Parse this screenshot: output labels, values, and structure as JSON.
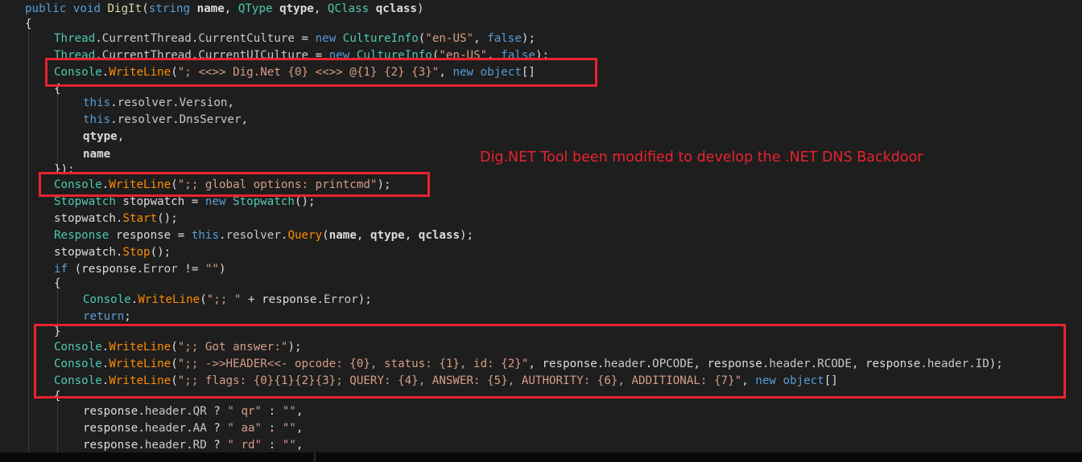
{
  "annotation": "Dig.NET Tool been modified to develop the .NET DNS Backdoor",
  "highlight_color": "#e8232f",
  "editor_background": "#1e1e1e",
  "code_lines": [
    [
      {
        "t": "public ",
        "c": "kw"
      },
      {
        "t": "void ",
        "c": "kw"
      },
      {
        "t": "DigIt",
        "c": "mb"
      },
      {
        "t": "(",
        "c": ""
      },
      {
        "t": "string ",
        "c": "kw"
      },
      {
        "t": "name",
        "c": "bd"
      },
      {
        "t": ", ",
        "c": ""
      },
      {
        "t": "QType ",
        "c": "ty"
      },
      {
        "t": "qtype",
        "c": "bd"
      },
      {
        "t": ", ",
        "c": ""
      },
      {
        "t": "QClass ",
        "c": "ty"
      },
      {
        "t": "qclass",
        "c": "bd"
      },
      {
        "t": ")",
        "c": ""
      }
    ],
    [
      {
        "t": "{",
        "c": ""
      }
    ],
    [
      {
        "t": "Thread",
        "c": "ty"
      },
      {
        "t": ".",
        "c": ""
      },
      {
        "t": "CurrentThread",
        "c": "pr"
      },
      {
        "t": ".",
        "c": ""
      },
      {
        "t": "CurrentCulture",
        "c": "pr"
      },
      {
        "t": " = ",
        "c": ""
      },
      {
        "t": "new ",
        "c": "kw"
      },
      {
        "t": "CultureInfo",
        "c": "ty"
      },
      {
        "t": "(",
        "c": ""
      },
      {
        "t": "\"en-US\"",
        "c": "st"
      },
      {
        "t": ", ",
        "c": ""
      },
      {
        "t": "false",
        "c": "kw"
      },
      {
        "t": ");",
        "c": ""
      }
    ],
    [
      {
        "t": "Thread",
        "c": "ty"
      },
      {
        "t": ".",
        "c": ""
      },
      {
        "t": "CurrentThread",
        "c": "pr"
      },
      {
        "t": ".",
        "c": ""
      },
      {
        "t": "CurrentUICulture",
        "c": "pr"
      },
      {
        "t": " = ",
        "c": ""
      },
      {
        "t": "new ",
        "c": "kw"
      },
      {
        "t": "CultureInfo",
        "c": "ty"
      },
      {
        "t": "(",
        "c": ""
      },
      {
        "t": "\"en-US\"",
        "c": "st"
      },
      {
        "t": ", ",
        "c": ""
      },
      {
        "t": "false",
        "c": "kw"
      },
      {
        "t": ");",
        "c": ""
      }
    ],
    [
      {
        "t": "Console",
        "c": "ty"
      },
      {
        "t": ".",
        "c": ""
      },
      {
        "t": "WriteLine",
        "c": "fn"
      },
      {
        "t": "(",
        "c": ""
      },
      {
        "t": "\"; <<>> Dig.Net {0} <<>> @{1} {2} {3}\"",
        "c": "st"
      },
      {
        "t": ", ",
        "c": ""
      },
      {
        "t": "new ",
        "c": "kw"
      },
      {
        "t": "object",
        "c": "kw"
      },
      {
        "t": "[]",
        "c": ""
      }
    ],
    [
      {
        "t": "{",
        "c": ""
      }
    ],
    [
      {
        "t": "this",
        "c": "kw"
      },
      {
        "t": ".",
        "c": ""
      },
      {
        "t": "resolver",
        "c": "pr"
      },
      {
        "t": ".",
        "c": ""
      },
      {
        "t": "Version",
        "c": "pr"
      },
      {
        "t": ",",
        "c": ""
      }
    ],
    [
      {
        "t": "this",
        "c": "kw"
      },
      {
        "t": ".",
        "c": ""
      },
      {
        "t": "resolver",
        "c": "pr"
      },
      {
        "t": ".",
        "c": ""
      },
      {
        "t": "DnsServer",
        "c": "pr"
      },
      {
        "t": ",",
        "c": ""
      }
    ],
    [
      {
        "t": "qtype",
        "c": "bd"
      },
      {
        "t": ",",
        "c": ""
      }
    ],
    [
      {
        "t": "name",
        "c": "bd"
      }
    ],
    [
      {
        "t": "});",
        "c": ""
      }
    ],
    [
      {
        "t": "Console",
        "c": "ty"
      },
      {
        "t": ".",
        "c": ""
      },
      {
        "t": "WriteLine",
        "c": "fn"
      },
      {
        "t": "(",
        "c": ""
      },
      {
        "t": "\";; global options: printcmd\"",
        "c": "st"
      },
      {
        "t": ");",
        "c": ""
      }
    ],
    [
      {
        "t": "Stopwatch ",
        "c": "ty"
      },
      {
        "t": "stopwatch = ",
        "c": ""
      },
      {
        "t": "new ",
        "c": "kw"
      },
      {
        "t": "Stopwatch",
        "c": "ty"
      },
      {
        "t": "();",
        "c": ""
      }
    ],
    [
      {
        "t": "stopwatch.",
        "c": ""
      },
      {
        "t": "Start",
        "c": "fn"
      },
      {
        "t": "();",
        "c": ""
      }
    ],
    [
      {
        "t": "Response ",
        "c": "ty"
      },
      {
        "t": "response = ",
        "c": ""
      },
      {
        "t": "this",
        "c": "kw"
      },
      {
        "t": ".",
        "c": ""
      },
      {
        "t": "resolver",
        "c": "pr"
      },
      {
        "t": ".",
        "c": ""
      },
      {
        "t": "Query",
        "c": "fn"
      },
      {
        "t": "(",
        "c": ""
      },
      {
        "t": "name",
        "c": "bd"
      },
      {
        "t": ", ",
        "c": ""
      },
      {
        "t": "qtype",
        "c": "bd"
      },
      {
        "t": ", ",
        "c": ""
      },
      {
        "t": "qclass",
        "c": "bd"
      },
      {
        "t": ");",
        "c": ""
      }
    ],
    [
      {
        "t": "stopwatch.",
        "c": ""
      },
      {
        "t": "Stop",
        "c": "fn"
      },
      {
        "t": "();",
        "c": ""
      }
    ],
    [
      {
        "t": "if ",
        "c": "kw"
      },
      {
        "t": "(response.",
        "c": ""
      },
      {
        "t": "Error",
        "c": "pr"
      },
      {
        "t": " != ",
        "c": ""
      },
      {
        "t": "\"\"",
        "c": "st"
      },
      {
        "t": ")",
        "c": ""
      }
    ],
    [
      {
        "t": "{",
        "c": ""
      }
    ],
    [
      {
        "t": "Console",
        "c": "ty"
      },
      {
        "t": ".",
        "c": ""
      },
      {
        "t": "WriteLine",
        "c": "fn"
      },
      {
        "t": "(",
        "c": ""
      },
      {
        "t": "\";; \"",
        "c": "st"
      },
      {
        "t": " + response.",
        "c": ""
      },
      {
        "t": "Error",
        "c": "pr"
      },
      {
        "t": ");",
        "c": ""
      }
    ],
    [
      {
        "t": "return",
        "c": "kw"
      },
      {
        "t": ";",
        "c": ""
      }
    ],
    [
      {
        "t": "}",
        "c": ""
      }
    ],
    [
      {
        "t": "Console",
        "c": "ty"
      },
      {
        "t": ".",
        "c": ""
      },
      {
        "t": "WriteLine",
        "c": "fn"
      },
      {
        "t": "(",
        "c": ""
      },
      {
        "t": "\";; Got answer:\"",
        "c": "st"
      },
      {
        "t": ");",
        "c": ""
      }
    ],
    [
      {
        "t": "Console",
        "c": "ty"
      },
      {
        "t": ".",
        "c": ""
      },
      {
        "t": "WriteLine",
        "c": "fn"
      },
      {
        "t": "(",
        "c": ""
      },
      {
        "t": "\";; ->>HEADER<<- opcode: {0}, status: {1}, id: {2}\"",
        "c": "st"
      },
      {
        "t": ", response.",
        "c": ""
      },
      {
        "t": "header",
        "c": "pr"
      },
      {
        "t": ".",
        "c": ""
      },
      {
        "t": "OPCODE",
        "c": "pr"
      },
      {
        "t": ", response.",
        "c": ""
      },
      {
        "t": "header",
        "c": "pr"
      },
      {
        "t": ".",
        "c": ""
      },
      {
        "t": "RCODE",
        "c": "pr"
      },
      {
        "t": ", response.",
        "c": ""
      },
      {
        "t": "header",
        "c": "pr"
      },
      {
        "t": ".",
        "c": ""
      },
      {
        "t": "ID",
        "c": "pr"
      },
      {
        "t": ");",
        "c": ""
      }
    ],
    [
      {
        "t": "Console",
        "c": "ty"
      },
      {
        "t": ".",
        "c": ""
      },
      {
        "t": "WriteLine",
        "c": "fn"
      },
      {
        "t": "(",
        "c": ""
      },
      {
        "t": "\";; flags: {0}{1}{2}{3}; QUERY: {4}, ANSWER: {5}, AUTHORITY: {6}, ADDITIONAL: {7}\"",
        "c": "st"
      },
      {
        "t": ", ",
        "c": ""
      },
      {
        "t": "new ",
        "c": "kw"
      },
      {
        "t": "object",
        "c": "kw"
      },
      {
        "t": "[]",
        "c": ""
      }
    ],
    [
      {
        "t": "{",
        "c": ""
      }
    ],
    [
      {
        "t": "response.",
        "c": ""
      },
      {
        "t": "header",
        "c": "pr"
      },
      {
        "t": ".",
        "c": ""
      },
      {
        "t": "QR",
        "c": "pr"
      },
      {
        "t": " ? ",
        "c": ""
      },
      {
        "t": "\" qr\"",
        "c": "st"
      },
      {
        "t": " : ",
        "c": ""
      },
      {
        "t": "\"\"",
        "c": "st"
      },
      {
        "t": ",",
        "c": ""
      }
    ],
    [
      {
        "t": "response.",
        "c": ""
      },
      {
        "t": "header",
        "c": "pr"
      },
      {
        "t": ".",
        "c": ""
      },
      {
        "t": "AA",
        "c": "pr"
      },
      {
        "t": " ? ",
        "c": ""
      },
      {
        "t": "\" aa\"",
        "c": "st"
      },
      {
        "t": " : ",
        "c": ""
      },
      {
        "t": "\"\"",
        "c": "st"
      },
      {
        "t": ",",
        "c": ""
      }
    ],
    [
      {
        "t": "response.",
        "c": ""
      },
      {
        "t": "header",
        "c": "pr"
      },
      {
        "t": ".",
        "c": ""
      },
      {
        "t": "RD",
        "c": "pr"
      },
      {
        "t": " ? ",
        "c": ""
      },
      {
        "t": "\" rd\"",
        "c": "st"
      },
      {
        "t": " : ",
        "c": ""
      },
      {
        "t": "\"\"",
        "c": "st"
      },
      {
        "t": ",",
        "c": ""
      }
    ]
  ]
}
